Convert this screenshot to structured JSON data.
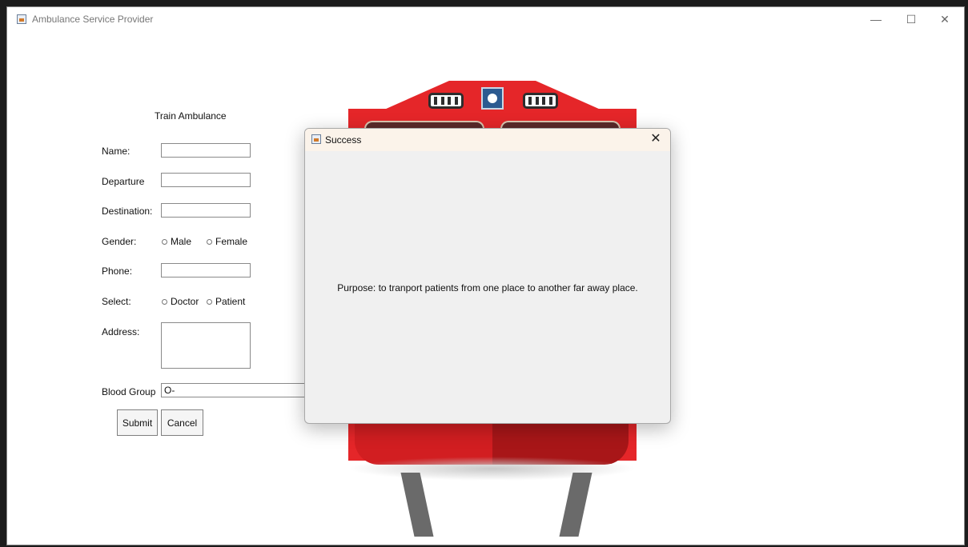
{
  "window": {
    "title": "Ambulance Service Provider",
    "minimize_glyph": "—",
    "maximize_glyph": "☐",
    "close_glyph": "✕"
  },
  "form": {
    "title": "Train Ambulance",
    "labels": {
      "name": "Name:",
      "departure": "Departure",
      "destination": "Destination:",
      "gender": "Gender:",
      "phone": "Phone:",
      "select": "Select:",
      "address": "Address:",
      "blood_group": "Blood Group"
    },
    "fields": {
      "name": "",
      "departure": "",
      "destination": "",
      "phone": "",
      "address": ""
    },
    "gender_options": [
      "Male",
      "Female"
    ],
    "select_options": [
      "Doctor",
      "Patient"
    ],
    "blood_group_value": "O-",
    "buttons": {
      "submit": "Submit",
      "cancel": "Cancel"
    }
  },
  "dialog": {
    "title": "Success",
    "close_glyph": "✕",
    "message": "Purpose: to tranport patients from one place to another far away place."
  },
  "icons": {
    "app": "java-app-icon",
    "dialog": "java-app-icon"
  },
  "colors": {
    "train_red": "#e52629",
    "dialog_title_bg": "#fbf3ea",
    "dialog_bg": "#f0f0f0"
  }
}
